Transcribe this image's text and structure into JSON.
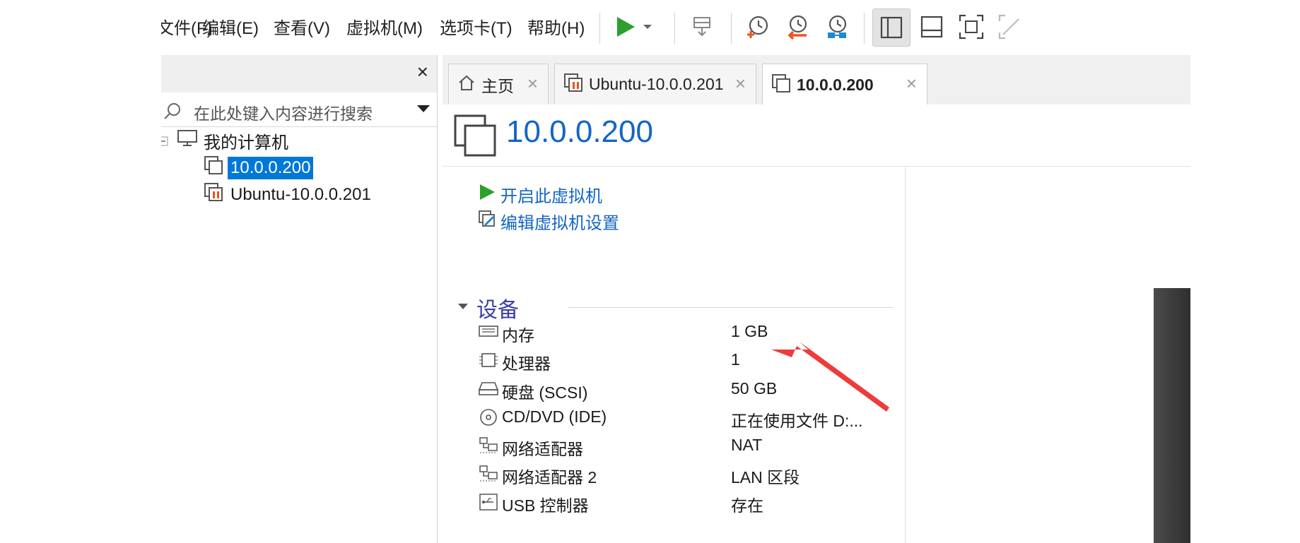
{
  "menu": {
    "items": [
      "文件(F)",
      "编辑(E)",
      "查看(V)",
      "虚拟机(M)",
      "选项卡(T)",
      "帮助(H)"
    ]
  },
  "toolbar": {
    "icons": [
      "play-icon",
      "dropdown-icon",
      "send-keys-icon",
      "snapshot-icon",
      "revert-snapshot-icon",
      "snapshot-manager-icon",
      "library-view-icon",
      "thumbnail-view-icon",
      "fullscreen-icon",
      "unity-icon"
    ],
    "play_color": "#2e9e2e"
  },
  "library": {
    "close_label": "×",
    "search_placeholder": "在此处键入内容进行搜索",
    "root_label": "我的计算机",
    "vms": [
      "10.0.0.200",
      "Ubuntu-10.0.0.201"
    ]
  },
  "tabs": [
    {
      "label": "主页",
      "icon": "home-icon"
    },
    {
      "label": "Ubuntu-10.0.0.201",
      "icon": "vm-suspended-icon"
    },
    {
      "label": "10.0.0.200",
      "icon": "vm-icon"
    }
  ],
  "tab_close": "×",
  "vm": {
    "title": "10.0.0.200",
    "actions": [
      "开启此虚拟机",
      "编辑虚拟机设置"
    ],
    "devices_title": "设备",
    "devices": [
      {
        "name": "内存",
        "value": "1 GB",
        "icon": "memory-icon"
      },
      {
        "name": "处理器",
        "value": "1",
        "icon": "cpu-icon"
      },
      {
        "name": "硬盘 (SCSI)",
        "value": "50 GB",
        "icon": "hard-disk-icon"
      },
      {
        "name": "CD/DVD (IDE)",
        "value": "正在使用文件 D:...",
        "icon": "cd-icon"
      },
      {
        "name": "网络适配器",
        "value": "NAT",
        "icon": "network-icon"
      },
      {
        "name": "网络适配器 2",
        "value": "LAN 区段",
        "icon": "network-icon"
      },
      {
        "name": "USB 控制器",
        "value": "存在",
        "icon": "usb-icon"
      }
    ]
  },
  "colors": {
    "accent": "#1366c4",
    "selection": "#0078d7",
    "section": "#3b3fa3",
    "annotation_arrow": "#ef3b3b"
  }
}
